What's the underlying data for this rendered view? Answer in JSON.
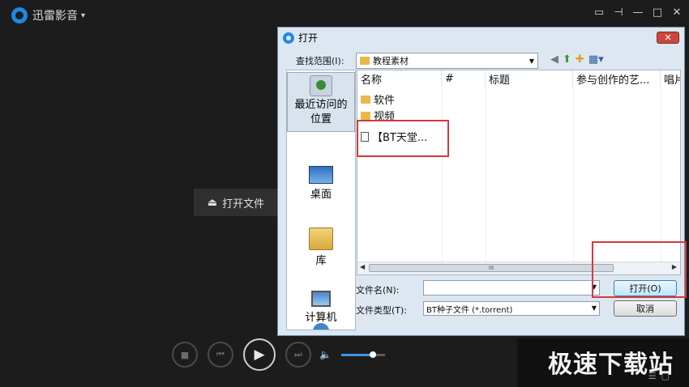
{
  "player": {
    "title": "迅雷影音",
    "open_file_label": "打开文件"
  },
  "volume": {
    "level": 0.72
  },
  "watermark": "极速下载站",
  "dialog": {
    "title": "打开",
    "close_label": "✕",
    "look_in_label": "查找范围(I):",
    "look_in_value": "教程素材",
    "places": [
      {
        "label": "最近访问的位置",
        "icon": "recent-places-icon"
      },
      {
        "label": "桌面",
        "icon": "desktop-icon"
      },
      {
        "label": "库",
        "icon": "library-icon"
      },
      {
        "label": "计算机",
        "icon": "computer-icon"
      }
    ],
    "columns": [
      "名称",
      "#",
      "标题",
      "参与创作的艺...",
      "唱片"
    ],
    "files": [
      {
        "name": "软件",
        "type": "folder"
      },
      {
        "name": "视频",
        "type": "folder"
      },
      {
        "name": "【BT天堂...",
        "type": "torrent"
      }
    ],
    "file_name_label": "文件名(N):",
    "file_name_value": "",
    "file_type_label": "文件类型(T):",
    "file_type_value": "BT种子文件 (*.torrent)",
    "open_button": "打开(O)",
    "cancel_button": "取消",
    "scroll_thumb": "III"
  },
  "colors": {
    "accent": "#3d96e6",
    "highlight": "#d33a3a"
  }
}
